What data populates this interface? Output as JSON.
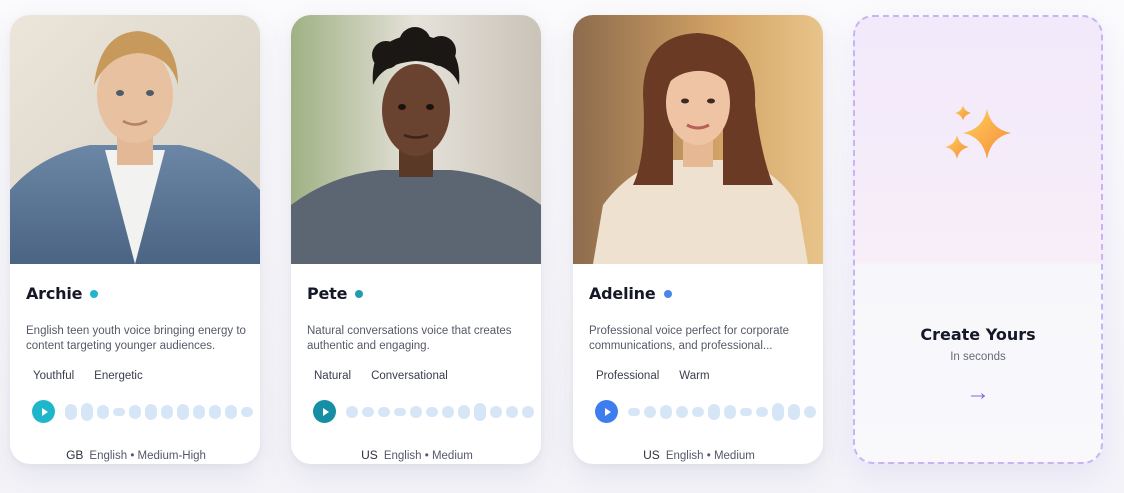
{
  "cards": [
    {
      "name": "Archie",
      "dot_color": "#22b5c9",
      "description": "English teen youth voice bringing energy to content targeting younger audiences.",
      "tags": [
        "Youthful",
        "Energetic"
      ],
      "play_color": "#1fb6cc",
      "country": "GB",
      "meta": "English • Medium-High",
      "photo_icon": "young-man-denim-jacket-photo"
    },
    {
      "name": "Pete",
      "dot_color": "#1f9eb0",
      "description": "Natural conversations voice that creates authentic and engaging.",
      "tags": [
        "Natural",
        "Conversational"
      ],
      "play_color": "#168ea4",
      "country": "US",
      "meta": "English • Medium",
      "photo_icon": "young-man-grey-tshirt-photo"
    },
    {
      "name": "Adeline",
      "dot_color": "#4a86e8",
      "description": "Professional voice perfect for corporate communications, and professional...",
      "tags": [
        "Professional",
        "Warm"
      ],
      "play_color": "#3d7df0",
      "country": "US",
      "meta": "English • Medium",
      "photo_icon": "woman-cream-blouse-photo"
    }
  ],
  "create": {
    "title": "Create Yours",
    "subtitle": "In seconds",
    "arrow": "→",
    "icon": "sparkles-icon"
  }
}
